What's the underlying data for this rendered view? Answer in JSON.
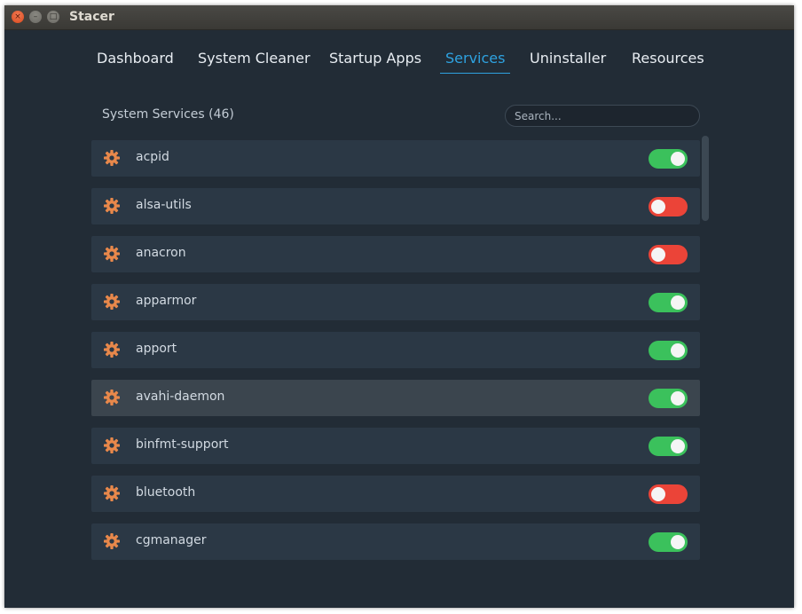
{
  "window": {
    "title": "Stacer"
  },
  "titlebar_buttons": {
    "close": "×",
    "minimize": "–",
    "maximize": "□"
  },
  "tabs": [
    {
      "label": "Dashboard",
      "active": false
    },
    {
      "label": "System Cleaner",
      "active": false
    },
    {
      "label": "Startup Apps",
      "active": false
    },
    {
      "label": "Services",
      "active": true
    },
    {
      "label": "Uninstaller",
      "active": false
    },
    {
      "label": "Resources",
      "active": false
    }
  ],
  "services": {
    "title": "System Services (46)",
    "search_placeholder": "Search...",
    "items": [
      {
        "name": "acpid",
        "enabled": true
      },
      {
        "name": "alsa-utils",
        "enabled": false
      },
      {
        "name": "anacron",
        "enabled": false
      },
      {
        "name": "apparmor",
        "enabled": true
      },
      {
        "name": "apport",
        "enabled": true
      },
      {
        "name": "avahi-daemon",
        "enabled": true,
        "hover": true
      },
      {
        "name": "binfmt-support",
        "enabled": true
      },
      {
        "name": "bluetooth",
        "enabled": false
      },
      {
        "name": "cgmanager",
        "enabled": true
      }
    ]
  },
  "icons": {
    "service": "gear-icon"
  },
  "colors": {
    "background": "#222c36",
    "row": "#2b3845",
    "row_hover": "#3b454e",
    "accent": "#2ea2e0",
    "toggle_on": "#3bc15c",
    "toggle_off": "#eb4438",
    "gear": "#e8884b"
  }
}
